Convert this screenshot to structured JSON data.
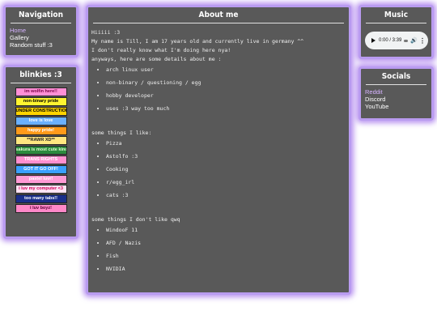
{
  "nav": {
    "title": "Navigation",
    "items": [
      "Home",
      "Gallery",
      "Random stuff :3"
    ]
  },
  "blinkies": {
    "title": "blinkies :3",
    "items": [
      {
        "label": "im wolfin here!!",
        "bg": "#ff8fd6",
        "fg": "#7a0048"
      },
      {
        "label": "non-binary pride",
        "bg": "#fff430",
        "fg": "#000000"
      },
      {
        "label": "UNDER CONSTRUCTION",
        "bg": "#ffd400",
        "fg": "#000000"
      },
      {
        "label": "love is love",
        "bg": "#6ab0ff",
        "fg": "#ffffff"
      },
      {
        "label": "happy pride!",
        "bg": "#ff9a1a",
        "fg": "#ffffff"
      },
      {
        "label": "**RAWR XD**",
        "bg": "#ffe680",
        "fg": "#222222"
      },
      {
        "label": "sakura is most cute kinda",
        "bg": "#2b8a3e",
        "fg": "#dfffd0"
      },
      {
        "label": "TRANS RIGHTS",
        "bg": "#ff8fcf",
        "fg": "#ffffff"
      },
      {
        "label": "GOT IT GO OFF!",
        "bg": "#3aa0ff",
        "fg": "#ffffff"
      },
      {
        "label": "pastel luvr!",
        "bg": "#ff9ad5",
        "fg": "#ffffff"
      },
      {
        "label": "i luv my computer <3",
        "bg": "#ffe3f3",
        "fg": "#d0005a"
      },
      {
        "label": "too many tabs!!",
        "bg": "#1a2f8a",
        "fg": "#ffffff"
      },
      {
        "label": "i luv boyz!",
        "bg": "#ff88c8",
        "fg": "#5a0036"
      }
    ]
  },
  "about": {
    "title": "About me",
    "lines": [
      "Hiiiii :3",
      "My name is Till, I am 17 years old and currently live in germany ^^",
      "I don't really know what I'm doing here nya!",
      "anyways, here are some details about me :"
    ],
    "details": [
      "arch linux user",
      "non-binary / questioning / egg",
      "hobby developer",
      "uses :3 way too much"
    ],
    "likes_heading": "some things I like:",
    "likes": [
      "Pizza",
      "Astolfo :3",
      "Cooking",
      "r/egg_irl",
      "cats :3"
    ],
    "dislikes_heading": "some things I don't like qwq",
    "dislikes": [
      "WindooF 11",
      "AFD / Nazis",
      "Fish",
      "NVIDIA"
    ]
  },
  "music": {
    "title": "Music",
    "time": "0:00 / 3:39"
  },
  "socials": {
    "title": "Socials",
    "items": [
      "Reddit",
      "Discord",
      "YouTube"
    ]
  }
}
